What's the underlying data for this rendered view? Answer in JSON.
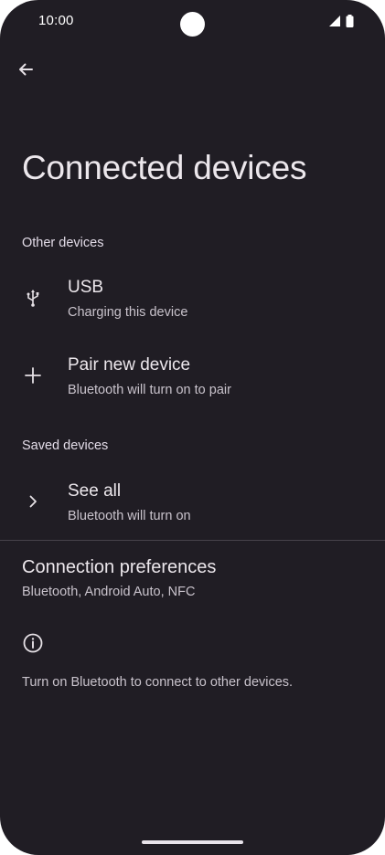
{
  "status_bar": {
    "time": "10:00",
    "icons": [
      "signal-icon",
      "battery-icon"
    ]
  },
  "toolbar": {
    "back_icon": "arrow-back-icon"
  },
  "page": {
    "title": "Connected devices"
  },
  "sections": {
    "other_devices": {
      "header": "Other devices",
      "items": [
        {
          "icon": "usb-icon",
          "title": "USB",
          "summary": "Charging this device"
        },
        {
          "icon": "plus-icon",
          "title": "Pair new device",
          "summary": "Bluetooth will turn on to pair"
        }
      ]
    },
    "saved_devices": {
      "header": "Saved devices",
      "items": [
        {
          "icon": "chevron-right-icon",
          "title": "See all",
          "summary": "Bluetooth will turn on"
        }
      ]
    }
  },
  "connection_preferences": {
    "title": "Connection preferences",
    "summary": "Bluetooth, Android Auto, NFC"
  },
  "footer": {
    "icon": "info-icon",
    "text": "Turn on Bluetooth to connect to other devices."
  },
  "colors": {
    "background": "#201d24",
    "text_primary": "#ece7ec",
    "text_secondary": "#c9c3cc",
    "divider": "#47434b"
  }
}
